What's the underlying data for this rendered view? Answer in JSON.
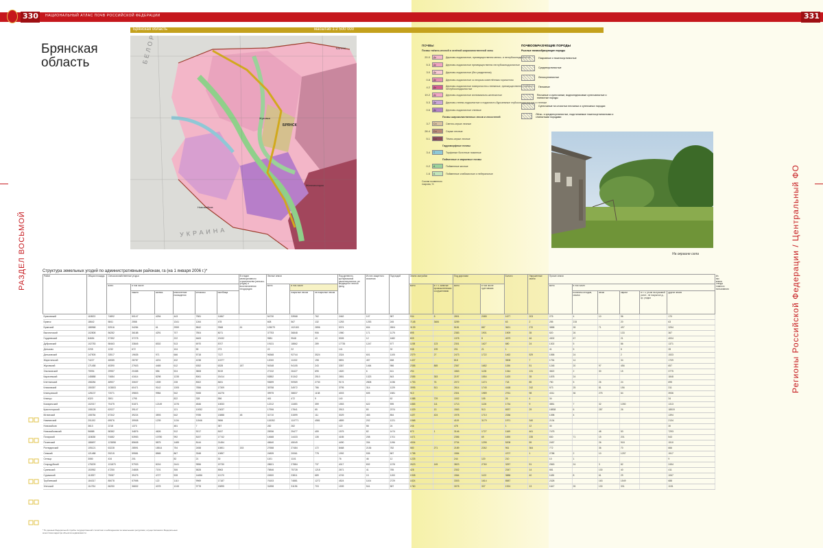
{
  "header": {
    "left_page_number": "330",
    "left_running": "НАЦИОНАЛЬНЫЙ АТЛАС ПОЧВ РОССИЙСКОЙ ФЕДЕРАЦИИ",
    "right_page_number": "331"
  },
  "map_bar": {
    "region": "Брянская область",
    "scale": "масштаб 1:2 500 000"
  },
  "title": "Брянская\nобласть",
  "map_labels": {
    "belarus": "БЕЛОРУССИЯ",
    "ukraine": "УКРАИНА",
    "kaluga": "КАЛУЖ.",
    "bryansk": "БРЯНСК",
    "zhukovka": "Жуковка",
    "novozybkov": "Новозыбков",
    "zheleznogorsk": "Железногорск"
  },
  "side_left": "РАЗДЕЛ ВОСЬМОЙ",
  "side_right": "Регионы Российской Федерации / Центральный ФО",
  "legend": {
    "soils_heading": "ПОЧВЫ",
    "soils_subheading": "Почвы таёжно-лесной и зелёной широколиственной зоны",
    "soils": [
      {
        "value": "20.0",
        "code": "Дп",
        "label": "Дерново-подзолистые, преимущественно мелко- и неглубокоподзолистые",
        "color": "#f5b8c8"
      },
      {
        "value": "5.3",
        "code": "Дп",
        "label": "Дерново-подзолистые преимущественно неглубокоподзолистые",
        "color": "#f2a3c0"
      },
      {
        "value": "3.0",
        "code": "Дп",
        "label": "Дерново-подзолистые (без разделения)",
        "color": "#f9c9d3"
      },
      {
        "value": "0.8",
        "code": "Дп",
        "label": "Дерново-подзолистые со вторым осветлённым горизонтом",
        "color": "#e58fb0"
      },
      {
        "value": "4.2",
        "code": "Дп",
        "label": "Дерново-подзолистые поверхностно-глееватые, преимущественно глубоко- и неглубокоподзолистые",
        "color": "#d35e8f"
      },
      {
        "value": "19.2",
        "code": "Дп",
        "label": "Дерново-подзолистые иллювиально-железистые",
        "color": "#f4a6c5"
      },
      {
        "value": "5.3",
        "code": "Дп",
        "label": "Дерново-глеево-подзолистые и подзолисто-буроземные глубокоподзолистые и глеевые",
        "color": "#c9a5d8"
      },
      {
        "value": "0.6",
        "code": "Дп",
        "label": "Дерново-подзолистые глеевые",
        "color": "#b583c7"
      }
    ],
    "broadleaf_heading": "Почвы широколиственных лесов и лесостепей",
    "broadleaf": [
      {
        "value": "3.7",
        "code": "Сл",
        "label": "Светло-серые лесные",
        "color": "#d9c3a0"
      },
      {
        "value": "28.4",
        "code": "Сл",
        "label": "Серые лесные",
        "color": "#b98a78"
      },
      {
        "value": "5.1",
        "code": "Сл",
        "label": "Тёмно-серые лесные",
        "color": "#8c4d5a"
      }
    ],
    "hydro_heading": "Гидроморфные почвы",
    "hydro": [
      {
        "value": "3.4",
        "code": "Т",
        "label": "Торфяные болотные низинные",
        "color": "#8fc8d6"
      }
    ],
    "alluvial_heading": "Пойменные и маршевые почвы",
    "alluvial": [
      {
        "value": "0.2",
        "code": "А",
        "label": "Пойменные кислые",
        "color": "#9bd29a"
      },
      {
        "value": "1.6",
        "code": "А",
        "label": "Пойменные слабокислые и нейтральные",
        "color": "#c2e5b9"
      }
    ],
    "share_note": "Состав почвенного покрова, %",
    "parent_heading": "ПОЧВООБРАЗУЮЩИЕ ПОРОДЫ",
    "parent_subheading": "Рыхлые почвообразующие породы",
    "parent": [
      "Покровные и тяжелосуглинистые",
      "Среднесуглинистые",
      "Легкосуглинистые",
      "Песчаные",
      "Песчаные и супесчаные, водноледниковые супесчанистые и глинистые породы",
      "Супесчаные на слоистых песчаных и супесчаных породах",
      "Лёгко- и среднесуглинистые, подстилаемые тяжелосуглинистыми и глинистыми породами"
    ]
  },
  "photo_caption": "На окраине села",
  "table": {
    "title": "Структура земельных угодий по административным районам, га (на 1 января 2006 г.)*",
    "header_groups": [
      "Район",
      "Общая площадь",
      "Сельскохозяйственные угодья",
      "В стадии мелиоративного строительства (сельско-угодья) и восстановления плодородия",
      "Лесные земли",
      "Под древесно-кустарниковой растительностью, не входящей в лесной фонд",
      "Из них защитного значения",
      "Под водой",
      "Земли застройки",
      "Под дорогами",
      "Болота",
      "Нарушенные земли",
      "Прочие земли",
      "Из них земли отвода главного пользования"
    ],
    "sub_headers": [
      "всего",
      "в том числе",
      "пашня",
      "залежь",
      "многолетние насаждения",
      "сенокосы",
      "пастбища",
      "всего",
      "в том числе",
      "покрытые лесом",
      "не покрытые лесом",
      "всего",
      "в т. ч. занятые промышленными сооружениями",
      "всего",
      "в том числе грунтовыми",
      "всего",
      "в том числе",
      "полигоны отходов, свалки",
      "пески",
      "овраги",
      "в т. ч. ун-ии на пусковой ратит., не покрытые д.-кр. угодья",
      "другие земли"
    ],
    "rows": [
      [
        "Брасовский",
        "118523",
        "74892",
        "50147",
        "4254",
        "443",
        "7581",
        "11867",
        "",
        "54730",
        "33968",
        "762",
        "2462",
        "107",
        "987",
        "934",
        "8",
        "2801",
        "2085",
        "1677",
        "203",
        "275",
        "4",
        "10",
        "96",
        "",
        "170"
      ],
      [
        "Брянск",
        "18642",
        "5841",
        "2558",
        "",
        "1341",
        "1264",
        "478",
        "",
        "608",
        "567",
        "132",
        "1253",
        "1253",
        "245",
        "7148",
        "3484",
        "3259",
        "",
        "63",
        "2",
        "255",
        "215",
        "",
        "20",
        "",
        "63"
      ],
      [
        "Брянский",
        "188968",
        "52516",
        "34284",
        "61",
        "2959",
        "5842",
        "9368",
        "61",
        "105079",
        "102183",
        "2896",
        "5374",
        "604",
        "2804",
        "3139",
        "",
        "5181",
        "887",
        "3621",
        "270",
        "3858",
        "28",
        "71",
        "497",
        "",
        "3254"
      ],
      [
        "Выгоничский",
        "102808",
        "56282",
        "36188",
        "4291",
        "707",
        "7804",
        "8071",
        "",
        "37753",
        "36848",
        "906",
        "1980",
        "171",
        "1175",
        "895",
        "",
        "2383",
        "1901",
        "1909",
        "35",
        "520",
        "26",
        "",
        "133",
        "",
        "367"
      ],
      [
        "Гордеевский",
        "84654",
        "57352",
        "37278",
        "",
        "222",
        "6463",
        "19432",
        "",
        "9581",
        "9548",
        "43",
        "5305",
        "12",
        "1682",
        "809",
        "",
        "1378",
        "8",
        "4579",
        "46",
        "4302",
        "67",
        "",
        "21",
        "",
        "4004"
      ],
      [
        "Дубровский",
        "102783",
        "58463",
        "33845",
        "8302",
        "513",
        "6970",
        "8707",
        "",
        "19131",
        "18862",
        "289",
        "17735",
        "1247",
        "577",
        "1198",
        "123",
        "2301",
        "1627",
        "680",
        "24",
        "1302",
        "5",
        "",
        "86",
        "",
        "1371"
      ],
      [
        "Дятьково",
        "2205",
        "1232",
        "672",
        "",
        "104",
        "55",
        "273",
        "",
        "22",
        "22",
        "",
        "141",
        "",
        "32",
        "538",
        "199",
        "201",
        "21",
        "1",
        "",
        "41",
        "5",
        "",
        "8",
        "",
        "28"
      ],
      [
        "Дятьковский",
        "147505",
        "33517",
        "19635",
        "971",
        "666",
        "5718",
        "7127",
        "",
        "96368",
        "92744",
        "3524",
        "2324",
        "601",
        "1105",
        "2379",
        "27",
        "2473",
        "1722",
        "1462",
        "529",
        "1558",
        "24",
        "",
        "2",
        "",
        "1533"
      ],
      [
        "Жирятинский",
        "74227",
        "48085",
        "28787",
        "4201",
        "432",
        "4238",
        "10377",
        "",
        "12000",
        "11002",
        "198",
        "5891",
        "457",
        "658",
        "1407",
        "",
        "818",
        "",
        "3508",
        "7",
        "1754",
        "14",
        "",
        "34",
        "",
        "1709"
      ],
      [
        "Жуковский",
        "171458",
        "45390",
        "27603",
        "4465",
        "612",
        "6352",
        "6328",
        "187",
        "94348",
        "94105",
        "243",
        "3357",
        "1464",
        "986",
        "2358",
        "865",
        "2367",
        "1682",
        "1156",
        "51",
        "1248",
        "20",
        "97",
        "456",
        "",
        "657"
      ],
      [
        "Злынковский",
        "75994",
        "29957",
        "20458",
        "556",
        "524",
        "3808",
        "5019",
        "",
        "27132",
        "26427",
        "695",
        "1820",
        "6",
        "611",
        "294",
        "",
        "1863",
        "1135",
        "1344",
        "131",
        "3822",
        "2",
        "30",
        "15",
        "",
        "3775"
      ],
      [
        "Карачевский",
        "148888",
        "74684",
        "41614",
        "8298",
        "1235",
        "8061",
        "15414",
        "",
        "53852",
        "51342",
        "2510",
        "2651",
        "1323",
        "843",
        "2355",
        "353",
        "2197",
        "1554",
        "1420",
        "35",
        "1878",
        "24",
        "",
        "",
        "",
        "1848"
      ],
      [
        "Клетнянский",
        "158284",
        "48907",
        "30637",
        "1539",
        "228",
        "8302",
        "8451",
        "",
        "93699",
        "90969",
        "2730",
        "9174",
        "2808",
        "1036",
        "1793",
        "76",
        "2072",
        "1474",
        "718",
        "85",
        "750",
        "5",
        "26",
        "24",
        "",
        "695"
      ],
      [
        "Климовский",
        "155357",
        "103803",
        "60471",
        "9142",
        "1305",
        "7856",
        "17309",
        "",
        "35758",
        "34972",
        "786",
        "3795",
        "314",
        "1229",
        "3995",
        "511",
        "2614",
        "1745",
        "4168",
        "242",
        "573",
        "25",
        "81",
        "156",
        "",
        "311"
      ],
      [
        "Клинцовский",
        "128137",
        "72071",
        "39803",
        "9984",
        "542",
        "9265",
        "16276",
        "",
        "39975",
        "38837",
        "1138",
        "4003",
        "605",
        "1581",
        "910",
        "",
        "2301",
        "1989",
        "2761",
        "98",
        "4311",
        "36",
        "275",
        "64",
        "",
        "3936"
      ],
      [
        "Клинцы",
        "6320",
        "3501",
        "1795",
        "",
        "822",
        "328",
        "556",
        "",
        "461",
        "472",
        "9",
        "140",
        "",
        "62",
        "1088",
        "729",
        "1002",
        "105",
        "26",
        "4",
        "34",
        "",
        "",
        "",
        "",
        "34"
      ],
      [
        "Комаричский",
        "102017",
        "70475",
        "51871",
        "12149",
        "1376",
        "4846",
        "10833",
        "",
        "12212",
        "11853",
        "359",
        "1553",
        "622",
        "595",
        "1865",
        "111",
        "1713",
        "1126",
        "1734",
        "9",
        "3851",
        "7",
        "32",
        "1050",
        "",
        "1313"
      ],
      [
        "Красногорский",
        "108128",
        "62027",
        "39147",
        "",
        "121",
        "10052",
        "13637",
        "",
        "17906",
        "17841",
        "65",
        "3913",
        "80",
        "2374",
        "1029",
        "13",
        "1563",
        "913",
        "6537",
        "29",
        "18838",
        "6",
        "287",
        "26",
        "",
        "18519"
      ],
      [
        "Мглинский",
        "108784",
        "67342",
        "39224",
        "3593",
        "642",
        "9785",
        "13888",
        "48",
        "31710",
        "31599",
        "111",
        "3029",
        "453",
        "854",
        "1187",
        "424",
        "1978",
        "1710",
        "2336",
        "",
        "1398",
        "4",
        "",
        "",
        "",
        "1394"
      ],
      [
        "Навлинский",
        "201192",
        "69576",
        "39908",
        "1239",
        "1134",
        "11546",
        "9656",
        "",
        "115352",
        "110771",
        "4581",
        "4859",
        "202",
        "1221",
        "1568",
        "",
        "4119",
        "3179",
        "1971",
        "340",
        "2134",
        "",
        "",
        "",
        "",
        "2134"
      ],
      [
        "Новозыбков",
        "3613",
        "2218",
        "1373",
        "",
        "481",
        "7",
        "357",
        "",
        "282",
        "282",
        "",
        "122",
        "58",
        "24",
        "246",
        "",
        "478",
        "",
        "1",
        "12",
        "30",
        "",
        "",
        "",
        "",
        "30"
      ],
      [
        "Новозыбковский",
        "96888",
        "58382",
        "34876",
        "4626",
        "512",
        "9217",
        "8157",
        "",
        "25936",
        "25477",
        "459",
        "1575",
        "82",
        "1474",
        "870",
        "1",
        "3146",
        "1727",
        "1169",
        "461",
        "7475",
        "",
        "48",
        "53",
        "",
        "7293"
      ],
      [
        "Погарский",
        "118638",
        "91682",
        "53953",
        "10780",
        "992",
        "8157",
        "17742",
        "",
        "14668",
        "14433",
        "135",
        "4185",
        "208",
        "1701",
        "1671",
        "",
        "2356",
        "69",
        "1690",
        "235",
        "830",
        "71",
        "15",
        "201",
        "",
        "543"
      ],
      [
        "Почепский",
        "188697",
        "123858",
        "85608",
        "5875",
        "1485",
        "8144",
        "21454",
        "",
        "45640",
        "45049",
        "",
        "4490",
        "334",
        "1196",
        "4004",
        "",
        "2704",
        "1295",
        "5208",
        "59",
        "2457",
        "",
        "26",
        "918",
        "",
        "1510"
      ],
      [
        "Рогнединский",
        "105121",
        "63228",
        "28591",
        "18514",
        "754",
        "2458",
        "10801",
        "153",
        "27658",
        "27484",
        "172",
        "8468",
        "2136",
        "782",
        "580",
        "271",
        "2189",
        "2262",
        "961",
        "364",
        "772",
        "",
        "36",
        "70",
        "",
        "666"
      ],
      [
        "Севский",
        "121488",
        "93215",
        "59581",
        "8565",
        "867",
        "3348",
        "10857",
        "",
        "24839",
        "20061",
        "778",
        "1992",
        "535",
        "587",
        "1798",
        "",
        "1554",
        "",
        "4707",
        "1",
        "2788",
        "2",
        "10",
        "1257",
        "",
        "1517"
      ],
      [
        "Сельцо",
        "3080",
        "434",
        "201",
        "",
        "82",
        "21",
        "30",
        "",
        "1101",
        "1101",
        "",
        "76",
        "46",
        "12",
        "1225",
        "",
        "244",
        "120",
        "210",
        "",
        "10",
        "1",
        "",
        "",
        "",
        "9"
      ],
      [
        "Стародубский",
        "178209",
        "131870",
        "97933",
        "8216",
        "2441",
        "9556",
        "19730",
        "",
        "28621",
        "27884",
        "737",
        "4017",
        "832",
        "1376",
        "2623",
        "145",
        "3823",
        "2760",
        "3257",
        "51",
        "2563",
        "24",
        "3",
        "82",
        "",
        "2454"
      ],
      [
        "Суземский",
        "153952",
        "47250",
        "24808",
        "7191",
        "306",
        "5828",
        "8963",
        "",
        "75846",
        "75728",
        "1218",
        "2671",
        "41",
        "785",
        "428",
        "",
        "2302",
        "",
        "2347",
        "14",
        "581",
        "",
        "130",
        "40",
        "",
        "411"
      ],
      [
        "Суражский",
        "112837",
        "75087",
        "39475",
        "4727",
        "528",
        "14656",
        "10170",
        "",
        "24500",
        "23811",
        "689",
        "4745",
        "15",
        "1153",
        "1908",
        "",
        "1564",
        "1122",
        "3888",
        "40",
        "1185",
        "8",
        "61",
        "29",
        "",
        "1067"
      ],
      [
        "Трубчевский",
        "184317",
        "85078",
        "57598",
        "122",
        "1110",
        "9969",
        "17187",
        "",
        "76153",
        "74881",
        "1272",
        "4524",
        "1104",
        "2729",
        "1824",
        "",
        "3303",
        "1614",
        "8587",
        "",
        "2328",
        "",
        "163",
        "1549",
        "",
        "688"
      ],
      [
        "Унечский",
        "114754",
        "66250",
        "36832",
        "4078",
        "1245",
        "9778",
        "15895",
        "",
        "31898",
        "31196",
        "703",
        "1539",
        "541",
        "587",
        "1760",
        "",
        "3078",
        "337",
        "1924",
        "13",
        "1647",
        "26",
        "130",
        "331",
        "",
        "1151"
      ]
    ]
  },
  "footnote": "* По данным Федеральной службы государственной статистики и наблюдениям за земельными ресурсами, осуществляемого Федеральным агентством кадастра объектов недвижимости."
}
